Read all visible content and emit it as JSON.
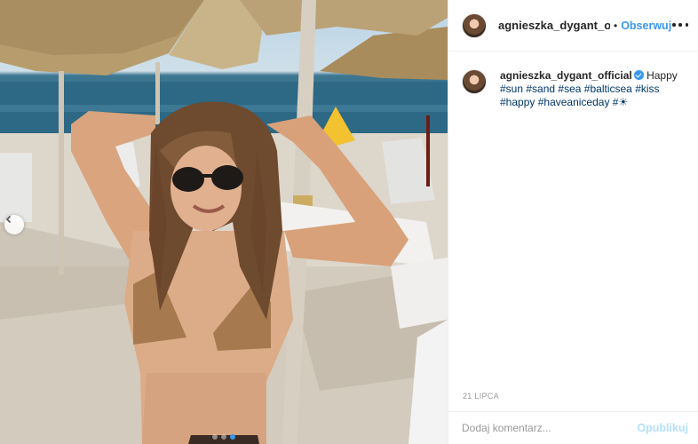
{
  "post": {
    "username": "agnieszka_dygant_offic",
    "separator": "•",
    "follow_label": "Obserwuj",
    "more_icon": "more-horizontal-icon"
  },
  "caption": {
    "username": "agnieszka_dygant_official",
    "verified_icon": "verified-badge-icon",
    "text_start": "Happy",
    "hashtags": [
      "#sun",
      "#sand",
      "#sea",
      "#balticsea",
      "#kiss",
      "#happy",
      "#haveaniceday",
      "#☀"
    ]
  },
  "date": "21 LIPCA",
  "comment": {
    "placeholder": "Dodaj komentarz...",
    "publish_label": "Opublikuj"
  },
  "carousel": {
    "prev_icon": "chevron-left-icon",
    "slide_count": 3,
    "active_index": 2
  },
  "colors": {
    "accent": "#3897f0",
    "publish_disabled": "#b2dffc",
    "text": "#262626",
    "muted": "#999999",
    "hashtag": "#003569"
  }
}
